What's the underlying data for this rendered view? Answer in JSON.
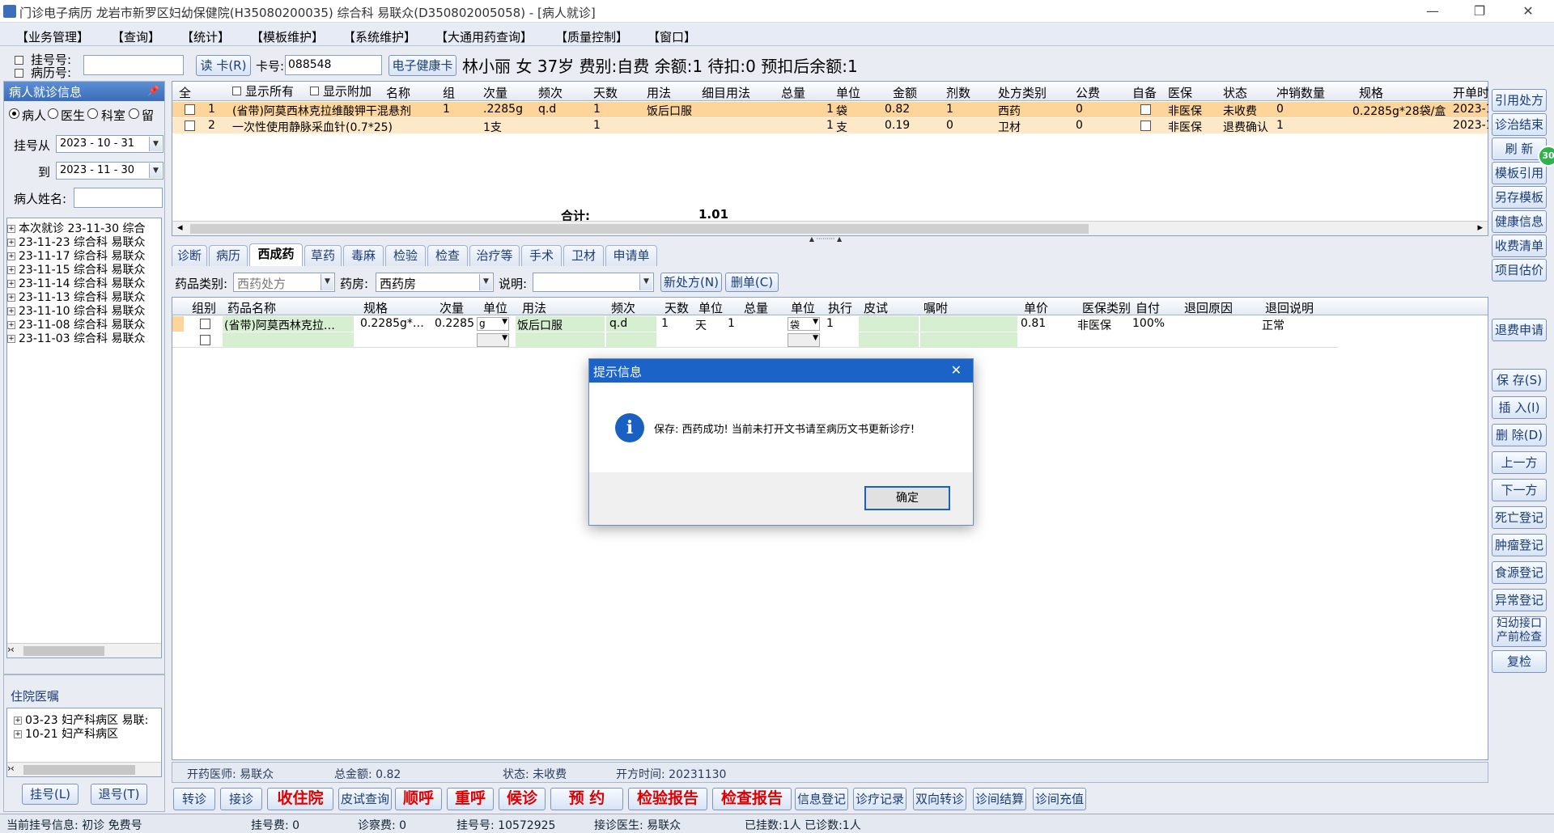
{
  "window": {
    "title": "门诊电子病历  龙岩市新罗区妇幼保健院(H35080200035)  综合科  易联众(D350802005058) - [病人就诊]",
    "minimize": "—",
    "restore": "❐",
    "close": "✕"
  },
  "menu": [
    "【业务管理】",
    "【查询】",
    "【统计】",
    "【模板维护】",
    "【系统维护】",
    "【大通用药查询】",
    "【质量控制】",
    "【窗口】"
  ],
  "patient_bar": {
    "reg_no_label": "挂号号:",
    "record_no_label": "病历号:",
    "read_card": "读 卡(R)",
    "card_label": "卡号:",
    "card_value": "088548",
    "health_card": "电子健康卡",
    "info": "林小丽  女  37岁  费别:自费  余额:1  待扣:0  预扣后余额:1"
  },
  "left_panel": {
    "header": "病人就诊信息",
    "radios": [
      "病人",
      "医生",
      "科室",
      "留"
    ],
    "date_from_label": "挂号从",
    "date_from": "2023 - 10 - 31",
    "date_to_label": "到",
    "date_to": "2023 - 11 - 30",
    "name_label": "病人姓名:",
    "visits": [
      "本次就诊  23-11-30  综合",
      "23-11-23  综合科  易联众",
      "23-11-17  综合科  易联众",
      "23-11-15  综合科  易联众",
      "23-11-14  综合科  易联众",
      "23-11-13  综合科  易联众",
      "23-11-10  综合科  易联众",
      "23-11-08  综合科  易联众",
      "23-11-03  综合科  易联众"
    ],
    "inpatient_header": "住院医嘱",
    "inpatient": [
      "03-23  妇产科病区  易联:",
      "10-21  妇产科病区"
    ],
    "reg_btn": "挂号(L)",
    "unreg_btn": "退号(T)"
  },
  "top_grid": {
    "headers": [
      "全",
      "显示所有",
      "显示附加",
      "名称",
      "组",
      "次量",
      "频次",
      "天数",
      "用法",
      "细目用法",
      "总量",
      "单位",
      "金额",
      "剂数",
      "处方类别",
      "公费",
      "自备",
      "医保",
      "状态",
      "冲销数量",
      "规格",
      "开单时"
    ],
    "rows": [
      {
        "no": "1",
        "name": "(省带)阿莫西林克拉维酸钾干混悬剂",
        "group": "1",
        "dose": ".2285g",
        "freq": "q.d",
        "days": "1",
        "usage": "饭后口服",
        "total": "1",
        "unit": "袋",
        "amount": "0.82",
        "doses": "1",
        "category": "西药",
        "public": "0",
        "insurance": "非医保",
        "status": "未收费",
        "offset": "0",
        "spec": "0.2285g*28袋/盒",
        "time": "2023-1"
      },
      {
        "no": "2",
        "name": "一次性使用静脉采血针(0.7*25)",
        "group": "",
        "dose": "1支",
        "freq": "",
        "days": "1",
        "usage": "",
        "total": "1",
        "unit": "支",
        "amount": "0.19",
        "doses": "0",
        "category": "卫材",
        "public": "0",
        "insurance": "非医保",
        "status": "退费确认",
        "offset": "1",
        "spec": "",
        "time": "2023-1"
      }
    ],
    "total_label": "合计:",
    "total_value": "1.01"
  },
  "tabs": [
    "诊断",
    "病历",
    "西成药",
    "草药",
    "毒麻",
    "检验",
    "检查",
    "治疗等",
    "手术",
    "卫材",
    "申请单"
  ],
  "filter": {
    "drug_type_label": "药品类别:",
    "drug_type": "西药处方",
    "pharmacy_label": "药房:",
    "pharmacy": "西药房",
    "note_label": "说明:",
    "new_rx": "新处方(N)",
    "del_rx": "删单(C)"
  },
  "rx_grid": {
    "headers": [
      "组别",
      "药品名称",
      "规格",
      "次量",
      "单位",
      "用法",
      "频次",
      "天数",
      "单位",
      "总量",
      "单位",
      "执行",
      "皮试",
      "嘱咐",
      "单价",
      "医保类别",
      "自付",
      "退回原因",
      "退回说明"
    ],
    "row": {
      "name": "(省带)阿莫西林克拉…",
      "spec": "0.2285g*…",
      "dose": "0.2285",
      "unit": "g",
      "usage": "饭后口服",
      "freq": "q.d",
      "days": "1",
      "day_unit": "天",
      "total": "1",
      "total_unit": "袋",
      "exec": "1",
      "price": "0.81",
      "insurance": "非医保",
      "self_pay": "100%",
      "note": "正常"
    }
  },
  "info_bar": {
    "doctor": "开药医师: 易联众",
    "amount": "总金额: 0.82",
    "status": "状态:  未收费",
    "time": "开方时间: 20231130"
  },
  "bottom_buttons": {
    "transfer": "转诊",
    "accept": "接诊",
    "admit": "收住院",
    "skin_test": "皮试查询",
    "call_next": "顺呼",
    "recall": "重呼",
    "waiting": "候诊",
    "appointment": "预 约",
    "lab_report": "检验报告",
    "exam_report": "检查报告",
    "info_reg": "信息登记",
    "records": "诊疗记录",
    "two_way": "双向转诊",
    "settle": "诊间结算",
    "recharge": "诊间充值"
  },
  "side_buttons": [
    "引用处方",
    "诊治结束",
    "刷 新",
    "模板引用",
    "另存模板",
    "健康信息",
    "收费清单",
    "项目估价",
    "退费申请",
    "保 存(S)",
    "插 入(I)",
    "删 除(D)",
    "上一方",
    "下一方",
    "死亡登记",
    "肿瘤登记",
    "食源登记",
    "异常登记",
    "妇幼接口\n产前检查",
    "复检"
  ],
  "badge": "30",
  "status_bar": {
    "reg_info": "当前挂号信息:  初诊 免费号",
    "reg_fee": "挂号费:  0",
    "diag_fee": "诊察费:  0",
    "reg_no": "挂号号:  10572925",
    "doctor": "接诊医生:  易联众",
    "counts": "已挂数:1人  已诊数:1人"
  },
  "dialog": {
    "title": "提示信息",
    "message": "保存:  西药成功! 当前未打开文书请至病历文书更新诊疗!",
    "ok": "确定",
    "close": "✕",
    "icon": "info-icon"
  }
}
